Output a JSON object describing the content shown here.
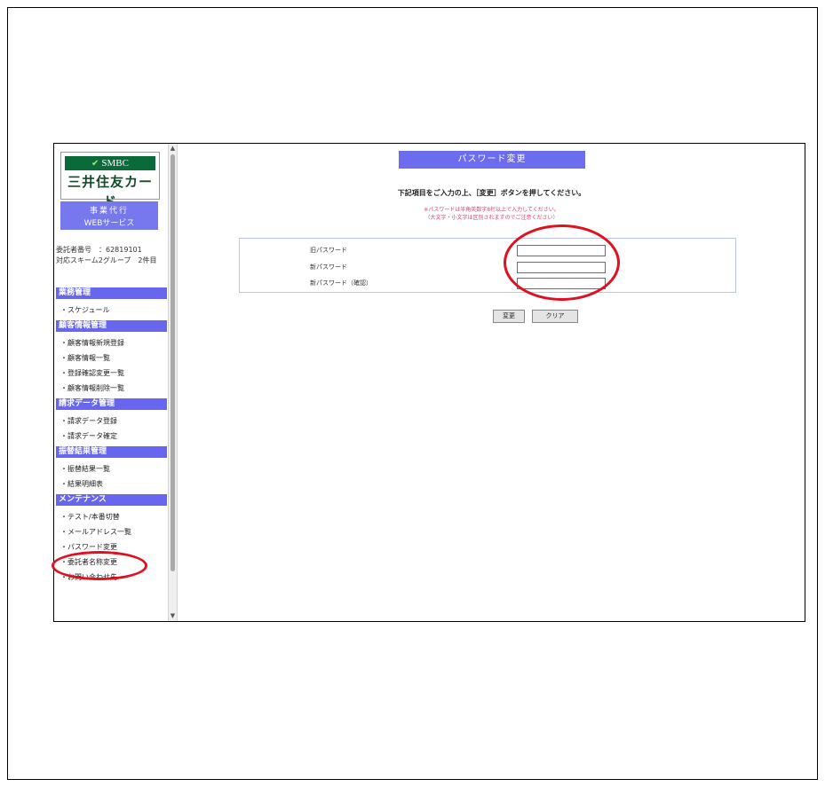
{
  "sidebar": {
    "logo_brand": "SMBC",
    "logo_card": "三井住友カード",
    "service_line1": "事業代行",
    "service_line2": "WEBサービス",
    "meta_line1": "委託者番号　：62819101",
    "meta_line2": "対応スキーム2グループ　2件目",
    "sections": [
      {
        "title": "業務管理",
        "items": [
          "・スケジュール"
        ]
      },
      {
        "title": "顧客情報管理",
        "items": [
          "・顧客情報新規登録",
          "・顧客情報一覧",
          "・登録確認変更一覧",
          "・顧客情報削除一覧"
        ]
      },
      {
        "title": "請求データ管理",
        "items": [
          "・請求データ登録",
          "・請求データ確定"
        ]
      },
      {
        "title": "振替結果管理",
        "items": [
          "・振替結果一覧",
          "・結果明細表"
        ]
      },
      {
        "title": "メンテナンス",
        "items": [
          "・テスト/本番切替",
          "・メールアドレス一覧",
          "・パスワード変更",
          "・委託者名称変更",
          "・お問い合わせ先"
        ]
      }
    ]
  },
  "main": {
    "title": "パスワード変更",
    "instruction": "下記項目をご入力の上、［変更］ボタンを押してください。",
    "warning_line1": "※パスワードは半角英数字8桁以上で入力してください。",
    "warning_line2": "（大文字・小文字は区別されますのでご注意ください）",
    "form": {
      "old_password_label": "旧パスワード",
      "new_password_label": "新パスワード",
      "confirm_password_label": "新パスワード（確認）",
      "old_password_value": "",
      "new_password_value": "",
      "confirm_password_value": ""
    },
    "change_button": "変更",
    "clear_button": "クリア"
  },
  "colors": {
    "accent": "#6666ee",
    "smbc_green": "#0a6a3a",
    "annotation_red": "#e01020",
    "warning_pink": "#e0406e"
  }
}
